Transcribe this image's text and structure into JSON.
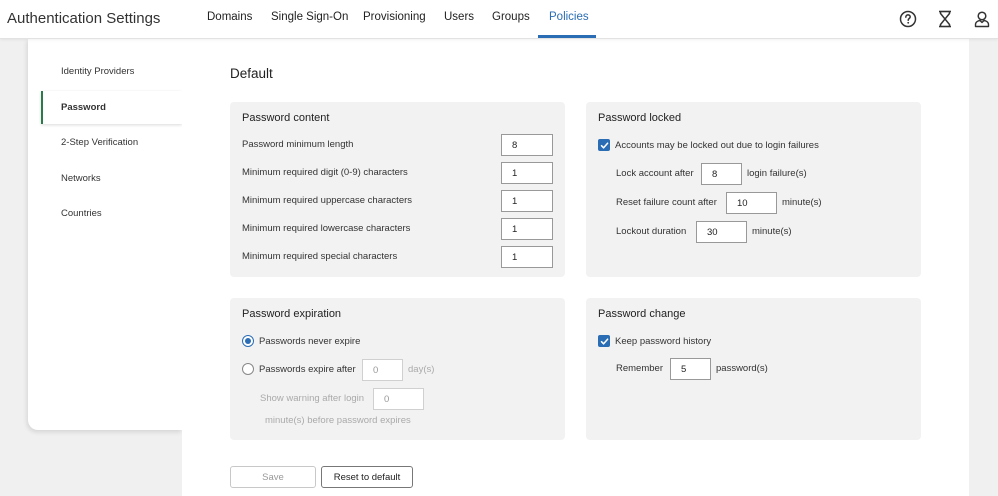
{
  "header": {
    "title": "Authentication Settings",
    "tabs": [
      "Domains",
      "Single Sign-On",
      "Provisioning",
      "Users",
      "Groups",
      "Policies"
    ],
    "active_tab": "Policies",
    "icons": [
      "help-circle-icon",
      "hourglass-icon",
      "user-icon"
    ],
    "accent_color": "#2a6db5"
  },
  "sidebar": {
    "items": [
      "Identity Providers",
      "Password",
      "2-Step Verification",
      "Networks",
      "Countries"
    ],
    "active_item": "Password",
    "active_border_color": "#2c7a4b"
  },
  "main": {
    "title": "Default",
    "password_content": {
      "title": "Password content",
      "fields": [
        {
          "label": "Password minimum length",
          "value": "8"
        },
        {
          "label": "Minimum required digit (0-9) characters",
          "value": "1"
        },
        {
          "label": "Minimum required uppercase characters",
          "value": "1"
        },
        {
          "label": "Minimum required lowercase characters",
          "value": "1"
        },
        {
          "label": "Minimum required special characters",
          "value": "1"
        }
      ]
    },
    "password_locked": {
      "title": "Password locked",
      "checkbox_label": "Accounts may be locked out due to login failures",
      "checked": true,
      "lock_after_label": "Lock account after",
      "lock_after_value": "8",
      "lock_after_unit": "login failure(s)",
      "reset_label": "Reset failure count after",
      "reset_value": "10",
      "reset_unit": "minute(s)",
      "duration_label": "Lockout duration",
      "duration_value": "30",
      "duration_unit": "minute(s)"
    },
    "password_expiration": {
      "title": "Password expiration",
      "option_never": "Passwords never expire",
      "option_after": "Passwords expire after",
      "selected": "never",
      "expire_value": "0",
      "expire_unit": "day(s)",
      "warning_label": "Show warning after login",
      "warning_value": "0",
      "warning_suffix": "minute(s) before password expires"
    },
    "password_change": {
      "title": "Password change",
      "checkbox_label": "Keep password history",
      "checked": true,
      "remember_label": "Remember",
      "remember_value": "5",
      "remember_unit": "password(s)"
    },
    "buttons": {
      "save": "Save",
      "reset": "Reset to default"
    }
  }
}
